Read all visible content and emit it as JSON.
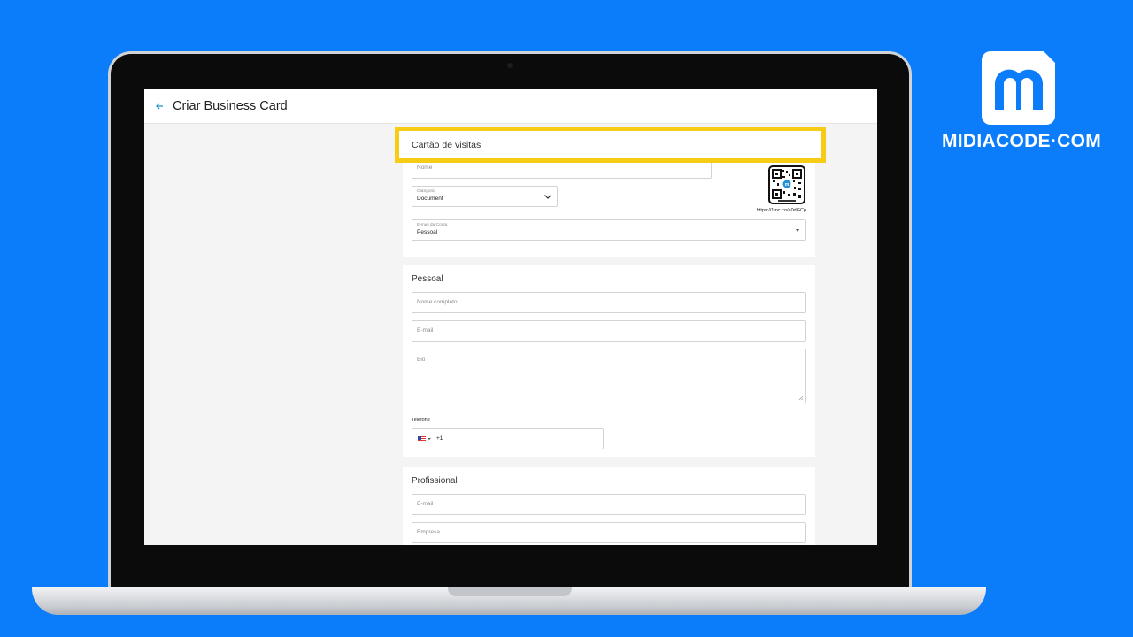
{
  "header": {
    "title": "Criar Business Card"
  },
  "highlight": {
    "label": "Cartão de visitas"
  },
  "card1": {
    "name_placeholder": "Nome",
    "category_label": "Categoria",
    "category_value": "Document",
    "account_email_label": "E-mail da Conta",
    "account_email_value": "Pessoal",
    "qr_link": "https://1mc.co/a0dGCp"
  },
  "personal": {
    "title": "Pessoal",
    "full_name_placeholder": "Nome completo",
    "email_placeholder": "E-mail",
    "bio_placeholder": "Bio",
    "phone_label": "Telefone",
    "phone_code": "+1"
  },
  "professional": {
    "title": "Profissional",
    "email_placeholder": "E-mail",
    "company_placeholder": "Empresa"
  },
  "brand": {
    "name": "MIDIACODE·COM"
  },
  "colors": {
    "background": "#0b7dfb",
    "highlight": "#f6cc17",
    "accent": "#1f8fd6"
  }
}
